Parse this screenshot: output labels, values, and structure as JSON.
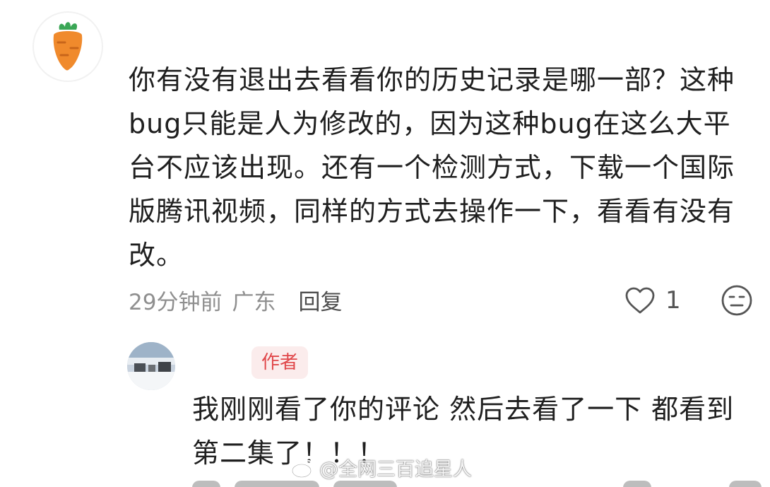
{
  "comment": {
    "avatar": "carrot-icon",
    "lines": [
      "你有没有退出去看看你的历史记录是哪一部？这种",
      "bug只能是人为修改的，因为这种bug在这么大平",
      "台不应该出现。还有一个检测方式，下载一个国际",
      "版腾讯视频，同样的方式去操作一下，看看有没有",
      "改。"
    ],
    "time": "29分钟前",
    "location": "广东",
    "reply_label": "回复",
    "like_count": "1",
    "like_icon": "heart-outline-icon",
    "dislike_icon": "meh-face-icon"
  },
  "reply": {
    "avatar": "snow-photo-avatar",
    "badge": "作者",
    "lines": [
      "我刚刚看了你的评论 然后去看了一下 都看到",
      "第二集了！！！"
    ]
  },
  "watermark": {
    "text": "@全网三百追星人",
    "icon": "weibo-icon"
  },
  "colors": {
    "badge_text": "#e0474a",
    "badge_bg": "#fbecec",
    "meta_gray": "#8f8f8f",
    "carrot_orange": "#f08a2c",
    "carrot_leaf": "#3aa655"
  }
}
